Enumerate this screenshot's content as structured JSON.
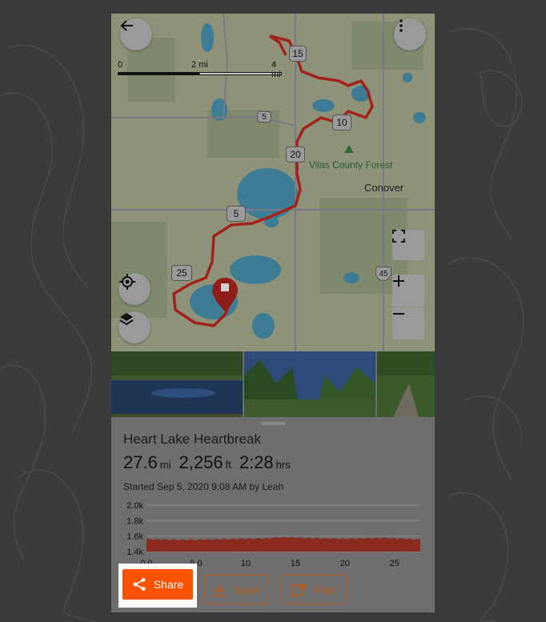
{
  "map": {
    "scale": {
      "labels": [
        "0",
        "2 mi",
        "4 mi"
      ]
    },
    "route_shields": [
      "15",
      "5",
      "10",
      "20",
      "5",
      "25"
    ],
    "us_shield": "45",
    "places": {
      "forest": "Vilas County Forest",
      "town": "Conover"
    },
    "icons": {
      "back": "arrow-left-icon",
      "more": "more-vertical-icon",
      "locate": "locate-icon",
      "layers": "layers-icon",
      "fullscreen": "fullscreen-icon",
      "zoom_in": "plus-icon",
      "zoom_out": "minus-icon",
      "marker": "start-marker-icon"
    }
  },
  "activity": {
    "title": "Heart Lake Heartbreak",
    "distance": "27.6",
    "distance_unit": "mi",
    "elevation": "2,256",
    "elevation_unit": "ft",
    "time": "2:28",
    "time_unit": "hrs",
    "started": "Started Sep 5, 2020 9:08 AM by Leah"
  },
  "chart_data": {
    "type": "area",
    "x_ticks": [
      "0.0",
      "5.0",
      "10",
      "15",
      "20",
      "25"
    ],
    "y_ticks": [
      "2.0k",
      "1.8k",
      "1.6k",
      "1.4k"
    ],
    "xlim": [
      0,
      27.6
    ],
    "ylim": [
      1400,
      2000
    ],
    "x": [
      0,
      2,
      4,
      6,
      8,
      10,
      12,
      14,
      16,
      18,
      20,
      22,
      24,
      26,
      27.6
    ],
    "y": [
      1560,
      1555,
      1550,
      1555,
      1560,
      1565,
      1570,
      1585,
      1575,
      1570,
      1565,
      1570,
      1575,
      1565,
      1555
    ],
    "color": "#8b2a1e"
  },
  "actions": {
    "share": "Share",
    "save": "Save",
    "plan": "Plan"
  },
  "colors": {
    "accent": "#fc5200",
    "route": "#c0201b"
  }
}
